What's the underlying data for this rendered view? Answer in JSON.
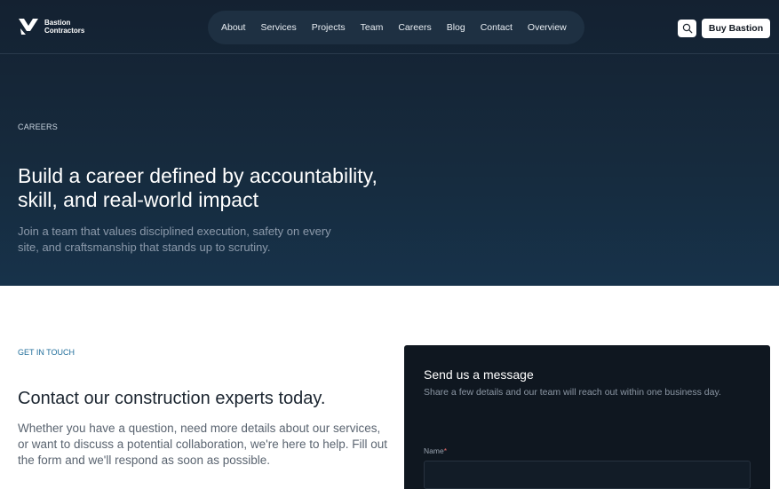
{
  "brand": {
    "line1": "Bastion",
    "line2": "Contractors"
  },
  "nav": {
    "items": [
      "About",
      "Services",
      "Projects",
      "Team",
      "Careers",
      "Blog",
      "Contact",
      "Overview"
    ]
  },
  "header": {
    "buy_label": "Buy Bastion",
    "search_icon": "search-icon"
  },
  "hero": {
    "eyebrow": "CAREERS",
    "title": "Build a career defined by accountability, skill, and real-world impact",
    "subtitle": "Join a team that values disciplined execution, safety on every site, and craftsmanship that stands up to scrutiny."
  },
  "contact": {
    "eyebrow": "GET IN TOUCH",
    "title": "Contact our construction experts today.",
    "text": "Whether you have a question, need more details about our services, or want to discuss a potential collaboration, we're here to help. Fill out the form and we'll respond as soon as possible."
  },
  "form": {
    "title": "Send us a message",
    "subtitle": "Share a few details and our team will reach out within one business day.",
    "name_label": "Name",
    "required_marker": "*",
    "name_value": ""
  },
  "colors": {
    "hero_bg": "#142131",
    "nav_pill": "#1e3042",
    "accent_eyebrow": "#1f6d9a",
    "form_bg": "#0f1720"
  }
}
